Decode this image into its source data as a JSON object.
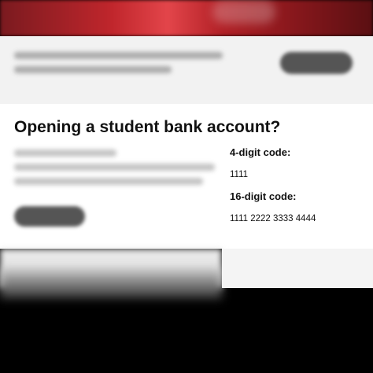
{
  "card": {
    "title": "Opening a student bank account?",
    "code4_label": "4-digit code:",
    "code4_value": "1111",
    "code16_label": "16-digit code:",
    "code16_value": "1111 2222 3333 4444"
  },
  "colors": {
    "hero": "#c0262c",
    "card_background": "#ffffff",
    "page_background": "#000000"
  }
}
